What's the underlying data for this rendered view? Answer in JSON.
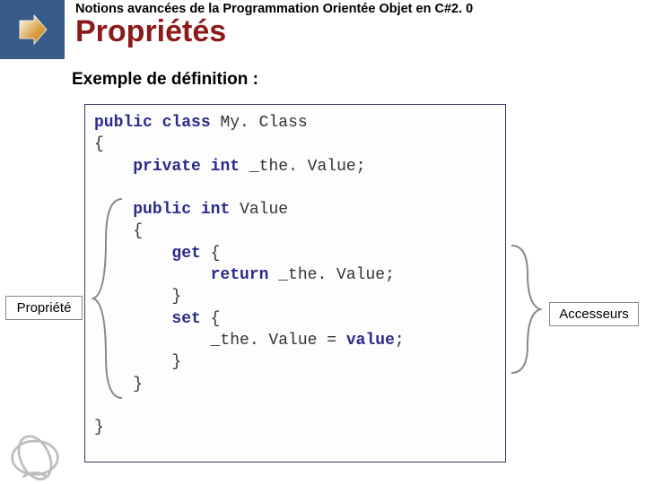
{
  "header": {
    "course_title": "Notions avancées de la Programmation Orientée Objet en C#2. 0",
    "page_title": "Propriétés"
  },
  "subtitle": "Exemple de définition :",
  "labels": {
    "left": "Propriété",
    "right": "Accesseurs"
  },
  "code": {
    "l1a": "public",
    "l1b": "class",
    "l1c": "My. Class",
    "l2": "{",
    "l3a": "private",
    "l3b": "int",
    "l3c": "_the. Value;",
    "blank1": "",
    "l5a": "public",
    "l5b": "int",
    "l5c": "Value",
    "l6": "{",
    "l7a": "get",
    "l7b": "{",
    "l8a": "return",
    "l8b": "_the. Value;",
    "l9": "}",
    "l10a": "set",
    "l10b": "{",
    "l11a": "_the. Value =",
    "l11b": "value",
    "l11c": ";",
    "l12": "}",
    "l13": "}",
    "blank2": "",
    "l14": "}"
  }
}
